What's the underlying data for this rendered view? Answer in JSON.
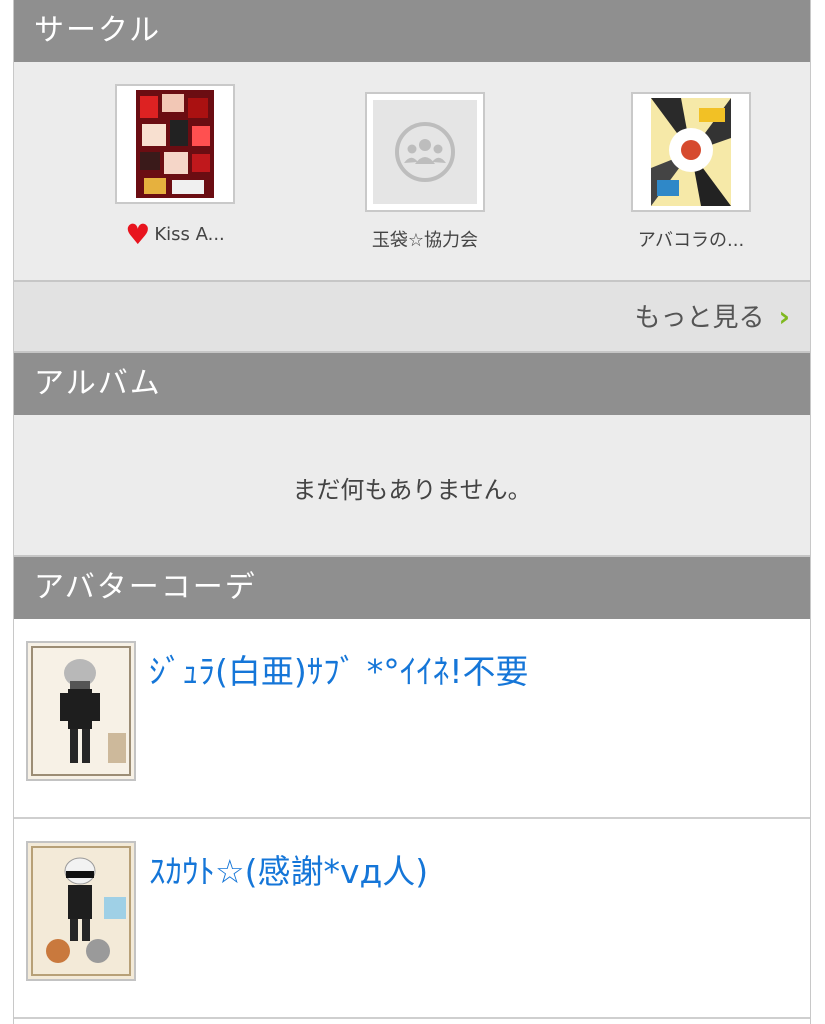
{
  "circle": {
    "header": "サークル",
    "items": [
      {
        "name": "Kiss A...",
        "favorite": true,
        "icon": "heart-icon"
      },
      {
        "name": "玉袋☆協力会",
        "icon": "group-icon"
      },
      {
        "name": "アバコラの..."
      }
    ],
    "more_label": "もっと見る",
    "more_icon": "chevron-right-icon"
  },
  "album": {
    "header": "アルバム",
    "empty_text": "まだ何もありません。"
  },
  "coords": {
    "header": "アバターコーデ",
    "items": [
      {
        "title": "ｼﾞｭﾗ(白亜)ｻﾌﾞ *°ｲｲﾈ!不要"
      },
      {
        "title": "ｽｶｳﾄ☆(感謝*vд人)"
      }
    ]
  },
  "colors": {
    "header_bg": "#8f8f8f",
    "link": "#1576d8",
    "chevron": "#7fb81f",
    "heart": "#e8141e"
  }
}
